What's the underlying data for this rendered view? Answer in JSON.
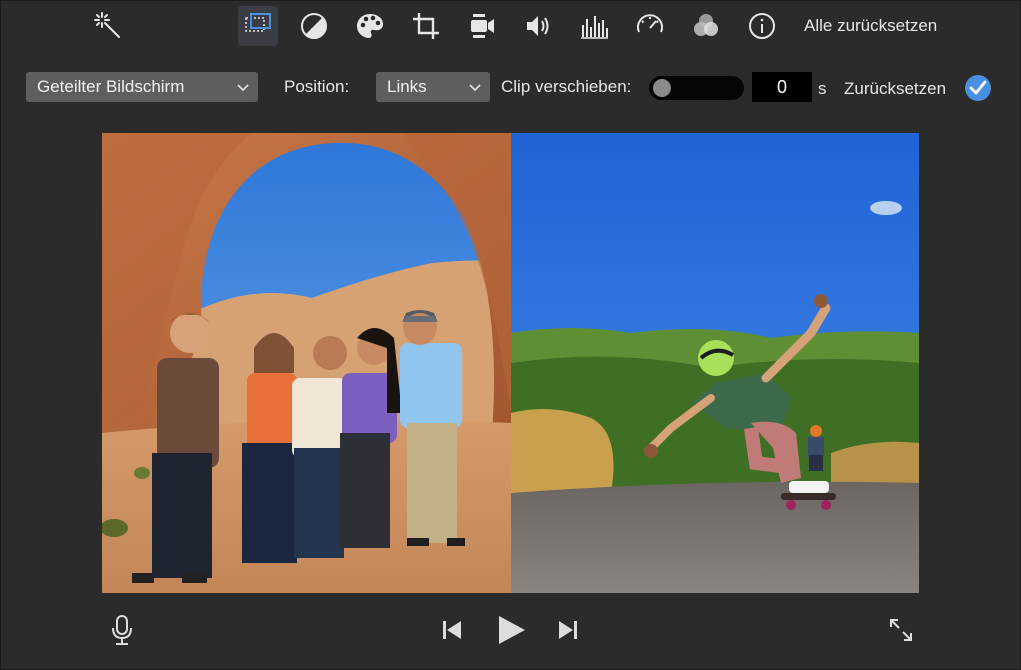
{
  "toolbar": {
    "reset_all_label": "Alle zurücksetzen",
    "icons": [
      "magic-wand-icon",
      "video-overlay-icon",
      "color-balance-icon",
      "color-correction-icon",
      "crop-icon",
      "stabilization-icon",
      "volume-icon",
      "noise-reduction-equalizer-icon",
      "speed-icon",
      "clip-filter-icon",
      "info-icon"
    ],
    "active": "video-overlay-icon"
  },
  "overlay_controls": {
    "overlay_type_selected": "Geteilter Bildschirm",
    "position_label": "Position:",
    "position_selected": "Links",
    "clip_shift_label": "Clip verschieben:",
    "clip_shift_value": "0",
    "clip_shift_unit": "s",
    "reset_label": "Zurücksetzen"
  },
  "viewer": {
    "left_clip": "group-photo-under-arch",
    "right_clip": "longboarder-on-road"
  },
  "colors": {
    "background": "#2b2b2b",
    "accent": "#4a90e2",
    "active_tool_bg": "#3a3d44"
  },
  "playback": {
    "icons": [
      "microphone-icon",
      "skip-back-icon",
      "play-icon",
      "skip-forward-icon",
      "fullscreen-icon"
    ]
  }
}
